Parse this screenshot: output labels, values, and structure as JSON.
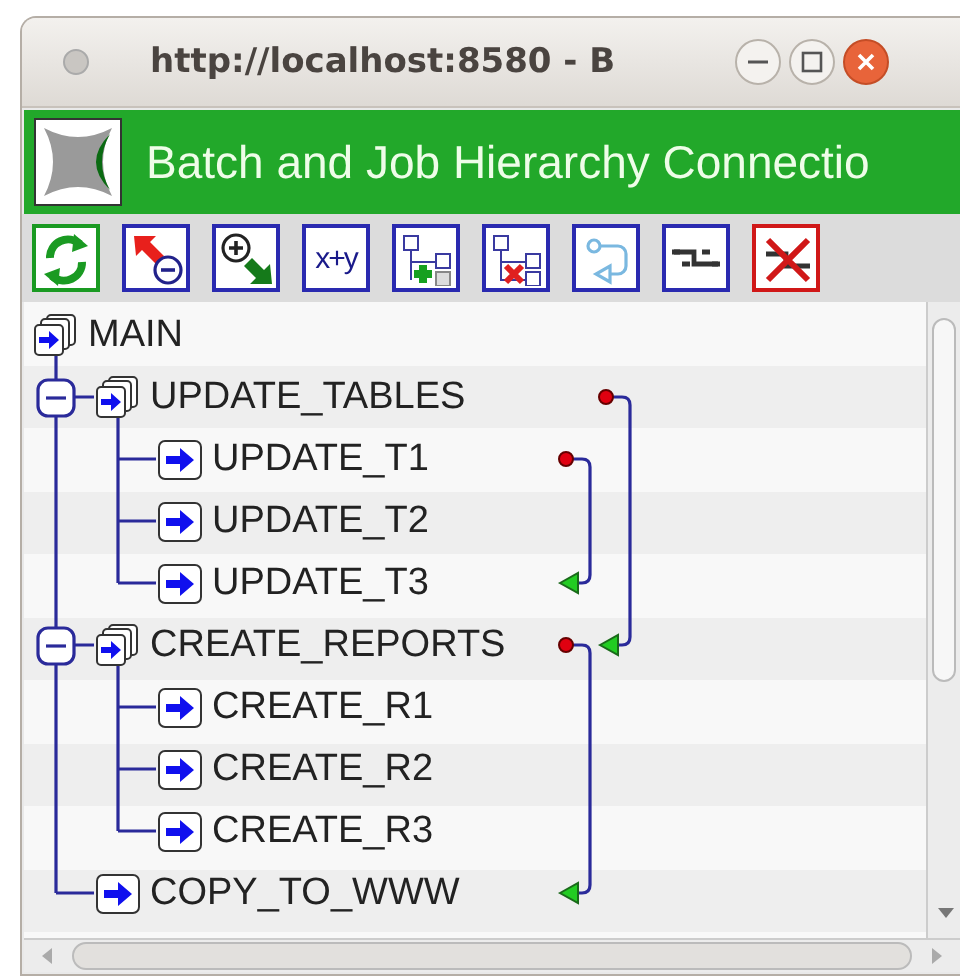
{
  "window": {
    "title": "http://localhost:8580 - B"
  },
  "header": {
    "title": "Batch and Job Hierarchy Connectio"
  },
  "toolbar": [
    {
      "kind": "refresh"
    },
    {
      "kind": "remove"
    },
    {
      "kind": "add"
    },
    {
      "kind": "text",
      "label": "x+y"
    },
    {
      "kind": "add_node"
    },
    {
      "kind": "delete_node"
    },
    {
      "kind": "link"
    },
    {
      "kind": "unlink"
    },
    {
      "kind": "delete_link"
    }
  ],
  "tree": [
    {
      "label": "MAIN",
      "kind": "batch",
      "link_out": false,
      "link_in": false,
      "children": [
        {
          "label": "UPDATE_TABLES",
          "kind": "batch",
          "expanded": true,
          "link_out": true,
          "link_in": false,
          "children": [
            {
              "label": "UPDATE_T1",
              "kind": "job",
              "link_out": true,
              "link_in": false
            },
            {
              "label": "UPDATE_T2",
              "kind": "job",
              "link_out": false,
              "link_in": false
            },
            {
              "label": "UPDATE_T3",
              "kind": "job",
              "link_out": false,
              "link_in": true
            }
          ]
        },
        {
          "label": "CREATE_REPORTS",
          "kind": "batch",
          "expanded": true,
          "link_out": true,
          "link_in": true,
          "children": [
            {
              "label": "CREATE_R1",
              "kind": "job",
              "link_out": false,
              "link_in": false
            },
            {
              "label": "CREATE_R2",
              "kind": "job",
              "link_out": false,
              "link_in": false
            },
            {
              "label": "CREATE_R3",
              "kind": "job",
              "link_out": false,
              "link_in": false
            }
          ]
        },
        {
          "label": "COPY_TO_WWW",
          "kind": "job",
          "link_out": false,
          "link_in": true
        }
      ]
    }
  ]
}
